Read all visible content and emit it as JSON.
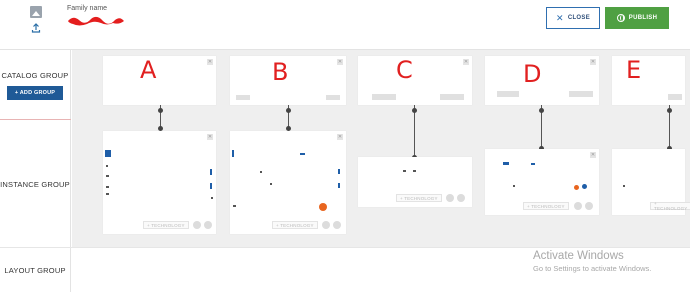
{
  "header": {
    "family_name_label": "Family name",
    "close_label": "CLOSE",
    "publish_label": "PUBLISH",
    "colors": {
      "publish": "#4fa042",
      "close_border": "#2f6fb0",
      "add_group": "#1f5a97"
    }
  },
  "rows": {
    "catalog_label": "CATALOG GROUP",
    "add_group_label": "+ ADD GROUP",
    "instance_label": "INSTANCE GROUP",
    "layout_label": "LAYOUT GROUP"
  },
  "catalog_cards": [
    {
      "annotation": "A"
    },
    {
      "annotation": "B"
    },
    {
      "annotation": "C"
    },
    {
      "annotation": "D"
    },
    {
      "annotation": "E"
    }
  ],
  "instance_cards": [
    {
      "technology_label": "+ TECHNOLOGY"
    },
    {
      "technology_label": "+ TECHNOLOGY"
    },
    {
      "technology_label": "+ TECHNOLOGY"
    },
    {
      "technology_label": "+ TECHNOLOGY"
    },
    {
      "technology_label": "+ TECHNOLOGY"
    }
  ],
  "watermark": {
    "title": "Activate Windows",
    "subtitle": "Go to Settings to activate Windows."
  },
  "icons": [
    "image-icon",
    "upload-icon",
    "close-icon",
    "globe-icon"
  ]
}
